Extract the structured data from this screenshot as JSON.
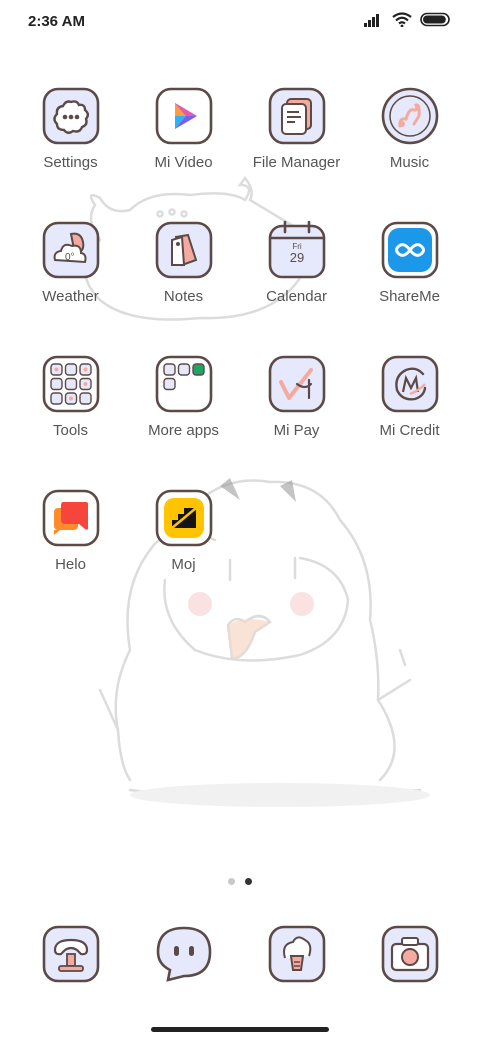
{
  "status": {
    "time": "2:36 AM",
    "battery_level": 0.95
  },
  "rows": [
    [
      {
        "label": "Settings",
        "icon": "settings-icon"
      },
      {
        "label": "Mi Video",
        "icon": "mi-video-icon"
      },
      {
        "label": "File Manager",
        "icon": "file-manager-icon"
      },
      {
        "label": "Music",
        "icon": "music-icon"
      }
    ],
    [
      {
        "label": "Weather",
        "icon": "weather-icon",
        "temp": "0°"
      },
      {
        "label": "Notes",
        "icon": "notes-icon"
      },
      {
        "label": "Calendar",
        "icon": "calendar-icon",
        "day": "Fri",
        "date": "29"
      },
      {
        "label": "ShareMe",
        "icon": "shareme-icon"
      }
    ],
    [
      {
        "label": "Tools",
        "icon": "tools-folder-icon"
      },
      {
        "label": "More apps",
        "icon": "more-apps-folder-icon"
      },
      {
        "label": "Mi Pay",
        "icon": "mi-pay-icon"
      },
      {
        "label": "Mi Credit",
        "icon": "mi-credit-icon"
      }
    ],
    [
      {
        "label": "Helo",
        "icon": "helo-icon"
      },
      {
        "label": "Moj",
        "icon": "moj-icon"
      }
    ]
  ],
  "page_indicator": {
    "count": 2,
    "active": 2
  },
  "dock": [
    {
      "icon": "phone-icon"
    },
    {
      "icon": "messages-icon"
    },
    {
      "icon": "browser-icon"
    },
    {
      "icon": "camera-icon"
    }
  ],
  "colors": {
    "icon_bg": "#e6e9fb",
    "outline": "#5b4a48",
    "accent_pink": "#f4aaa1"
  }
}
